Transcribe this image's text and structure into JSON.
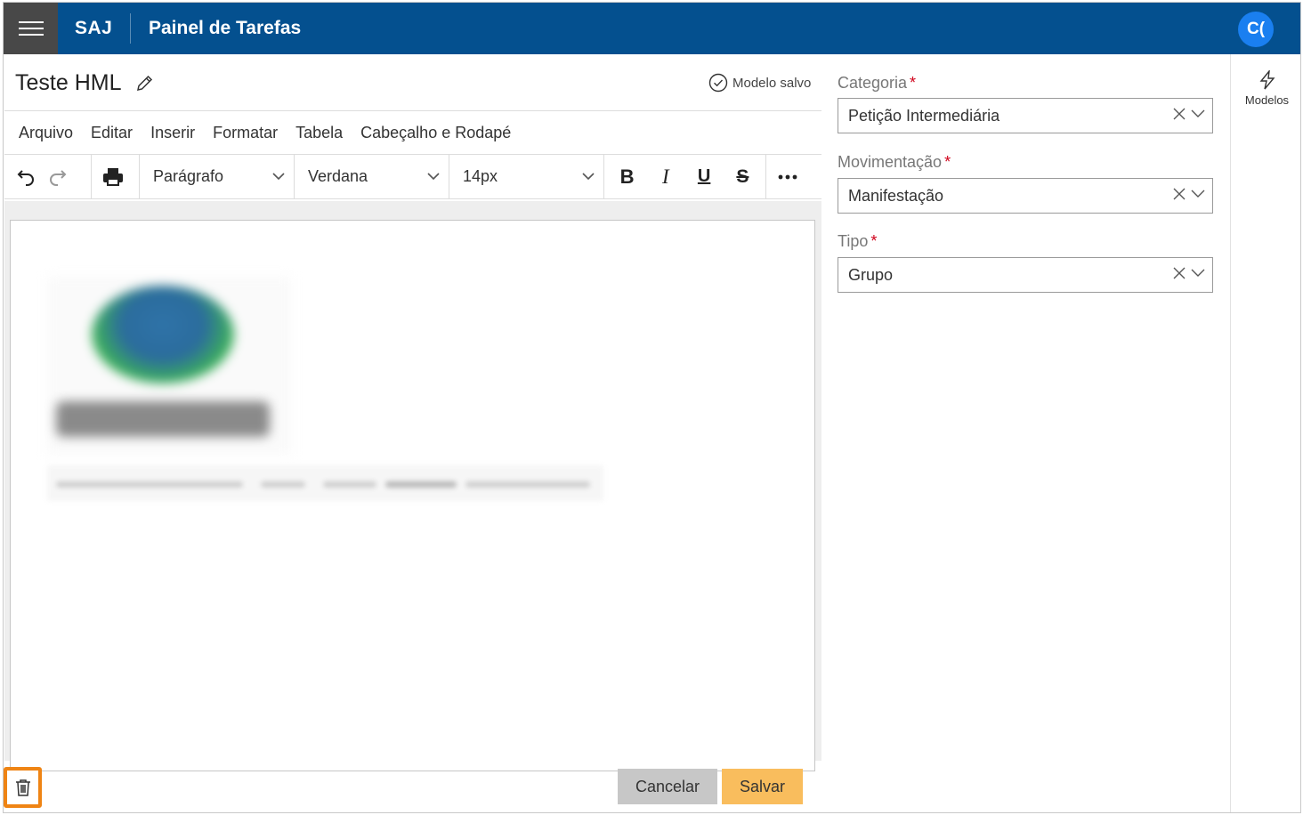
{
  "header": {
    "brand": "SAJ",
    "title": "Painel de Tarefas",
    "avatar_initials": "C(",
    "colors": {
      "bar": "#04508f",
      "menu_button": "#484848",
      "avatar": "#1a7ff0"
    }
  },
  "document": {
    "title": "Teste HML",
    "status": "Modelo salvo"
  },
  "editor": {
    "menu": [
      "Arquivo",
      "Editar",
      "Inserir",
      "Formatar",
      "Tabela",
      "Cabeçalho e Rodapé"
    ],
    "block_format": "Parágrafo",
    "font_family": "Verdana",
    "font_size": "14px",
    "format_buttons": {
      "bold": "B",
      "italic": "I",
      "underline": "U",
      "strike": "S"
    },
    "icons": [
      "undo-icon",
      "redo-icon",
      "print-icon",
      "more-icon"
    ]
  },
  "form": {
    "category": {
      "label": "Categoria",
      "required_mark": "*",
      "value": "Petição Intermediária"
    },
    "movement": {
      "label": "Movimentação",
      "required_mark": "*",
      "value": "Manifestação"
    },
    "type": {
      "label": "Tipo",
      "required_mark": "*",
      "value": "Grupo"
    }
  },
  "side_rail": {
    "templates_label": "Modelos"
  },
  "footer": {
    "cancel_label": "Cancelar",
    "save_label": "Salvar",
    "colors": {
      "cancel": "#c7c7c7",
      "save": "#f9bd5d",
      "delete_highlight": "#ef8414"
    }
  }
}
